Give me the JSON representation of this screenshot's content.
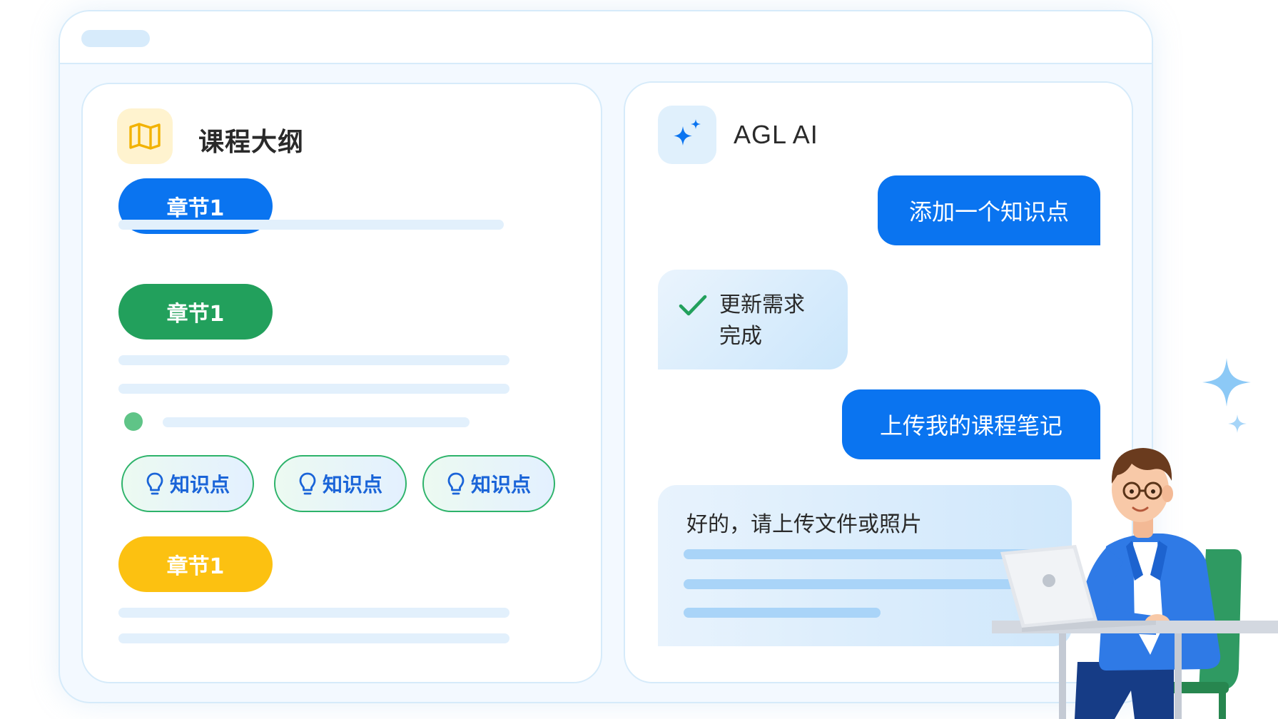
{
  "outline": {
    "title": "课程大纲",
    "chapters": [
      {
        "label": "章节1",
        "color": "#0a74f0"
      },
      {
        "label": "章节1",
        "color": "#22a05c"
      },
      {
        "label": "章节1",
        "color": "#fcc111"
      }
    ],
    "knowledge_points": [
      "知识点",
      "知识点",
      "知识点"
    ]
  },
  "assistant": {
    "title": "AGL AI",
    "messages": {
      "user_1": "添加一个知识点",
      "ai_1_line1": "更新需求",
      "ai_1_line2": "完成",
      "user_2": "上传我的课程笔记",
      "ai_2": "好的，请上传文件或照片"
    }
  },
  "colors": {
    "primary_blue": "#0a74f0",
    "green": "#22a05c",
    "yellow": "#fcc111",
    "light_border": "#d6ebfa"
  },
  "icons": {
    "outline_icon": "map-icon",
    "assistant_icon": "sparkle-icon",
    "knowledge_icon": "lightbulb-icon",
    "done_icon": "check-icon"
  }
}
